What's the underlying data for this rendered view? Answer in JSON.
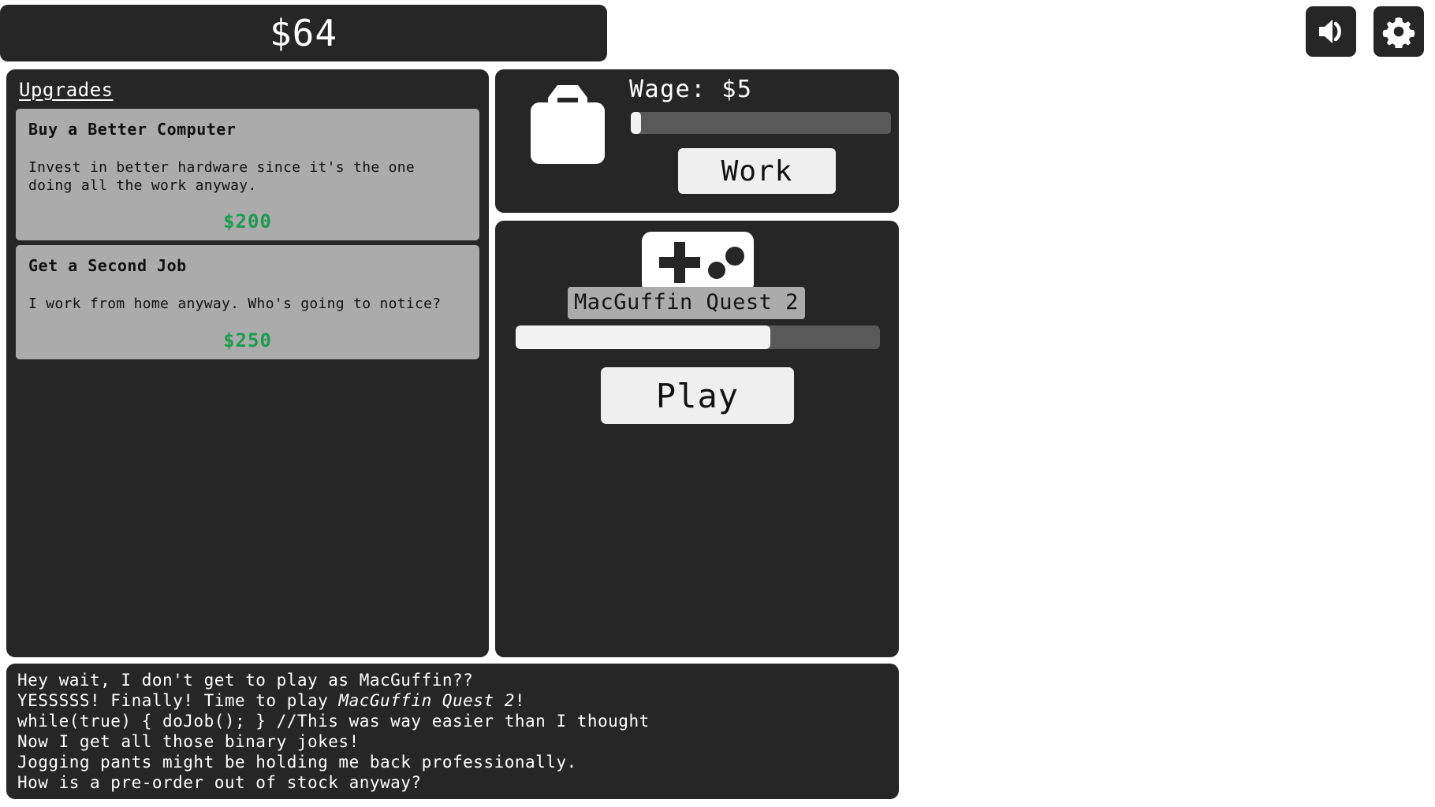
{
  "header": {
    "money": "$64",
    "sound_icon": "speaker-icon",
    "settings_icon": "gear-icon"
  },
  "upgrades": {
    "title": "Upgrades",
    "items": [
      {
        "name": "Buy a Better Computer",
        "description": "Invest in better hardware since it's the one doing all the work anyway.",
        "price": "$200"
      },
      {
        "name": "Get a Second Job",
        "description": "I work from home anyway. Who's going to notice?",
        "price": "$250"
      }
    ]
  },
  "job": {
    "icon": "briefcase-icon",
    "label": "Job",
    "wage_text": "Wage: $5",
    "progress_percent": 4,
    "work_button": "Work"
  },
  "game": {
    "icon": "gamepad-icon",
    "title": "MacGuffin Quest 2",
    "progress_percent": 70,
    "play_button": "Play"
  },
  "log": {
    "lines": [
      "Hey wait, I don't get to play as MacGuffin??",
      "YESSSSS! Finally! Time to play <i>MacGuffin Quest 2</i>!",
      "while(true) { doJob(); } //This was way easier than I thought",
      "Now I get all those binary jokes!",
      "Jogging pants might be holding me back professionally.",
      "How is a pre-order out of stock anyway?"
    ]
  },
  "colors": {
    "panel_bg": "#262626",
    "card_bg": "#ababab",
    "price_green": "#1a9c4e",
    "button_bg": "#efefef",
    "bar_track": "#595959",
    "bar_fill": "#f2f2f2"
  }
}
